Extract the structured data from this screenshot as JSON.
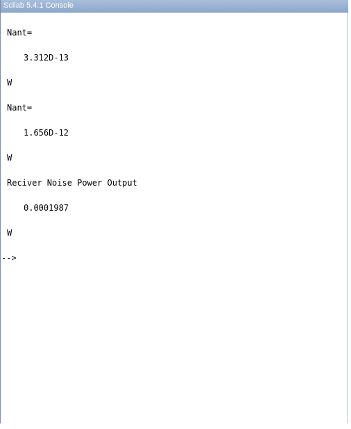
{
  "window": {
    "title": "Scilab 5.4.1 Console"
  },
  "console": {
    "lines": [
      "Nant=",
      "3.312D-13",
      "W",
      "Nant=",
      "1.656D-12",
      "W",
      "Reciver Noise Power Output",
      "0.0001987",
      "W",
      "-->"
    ]
  }
}
